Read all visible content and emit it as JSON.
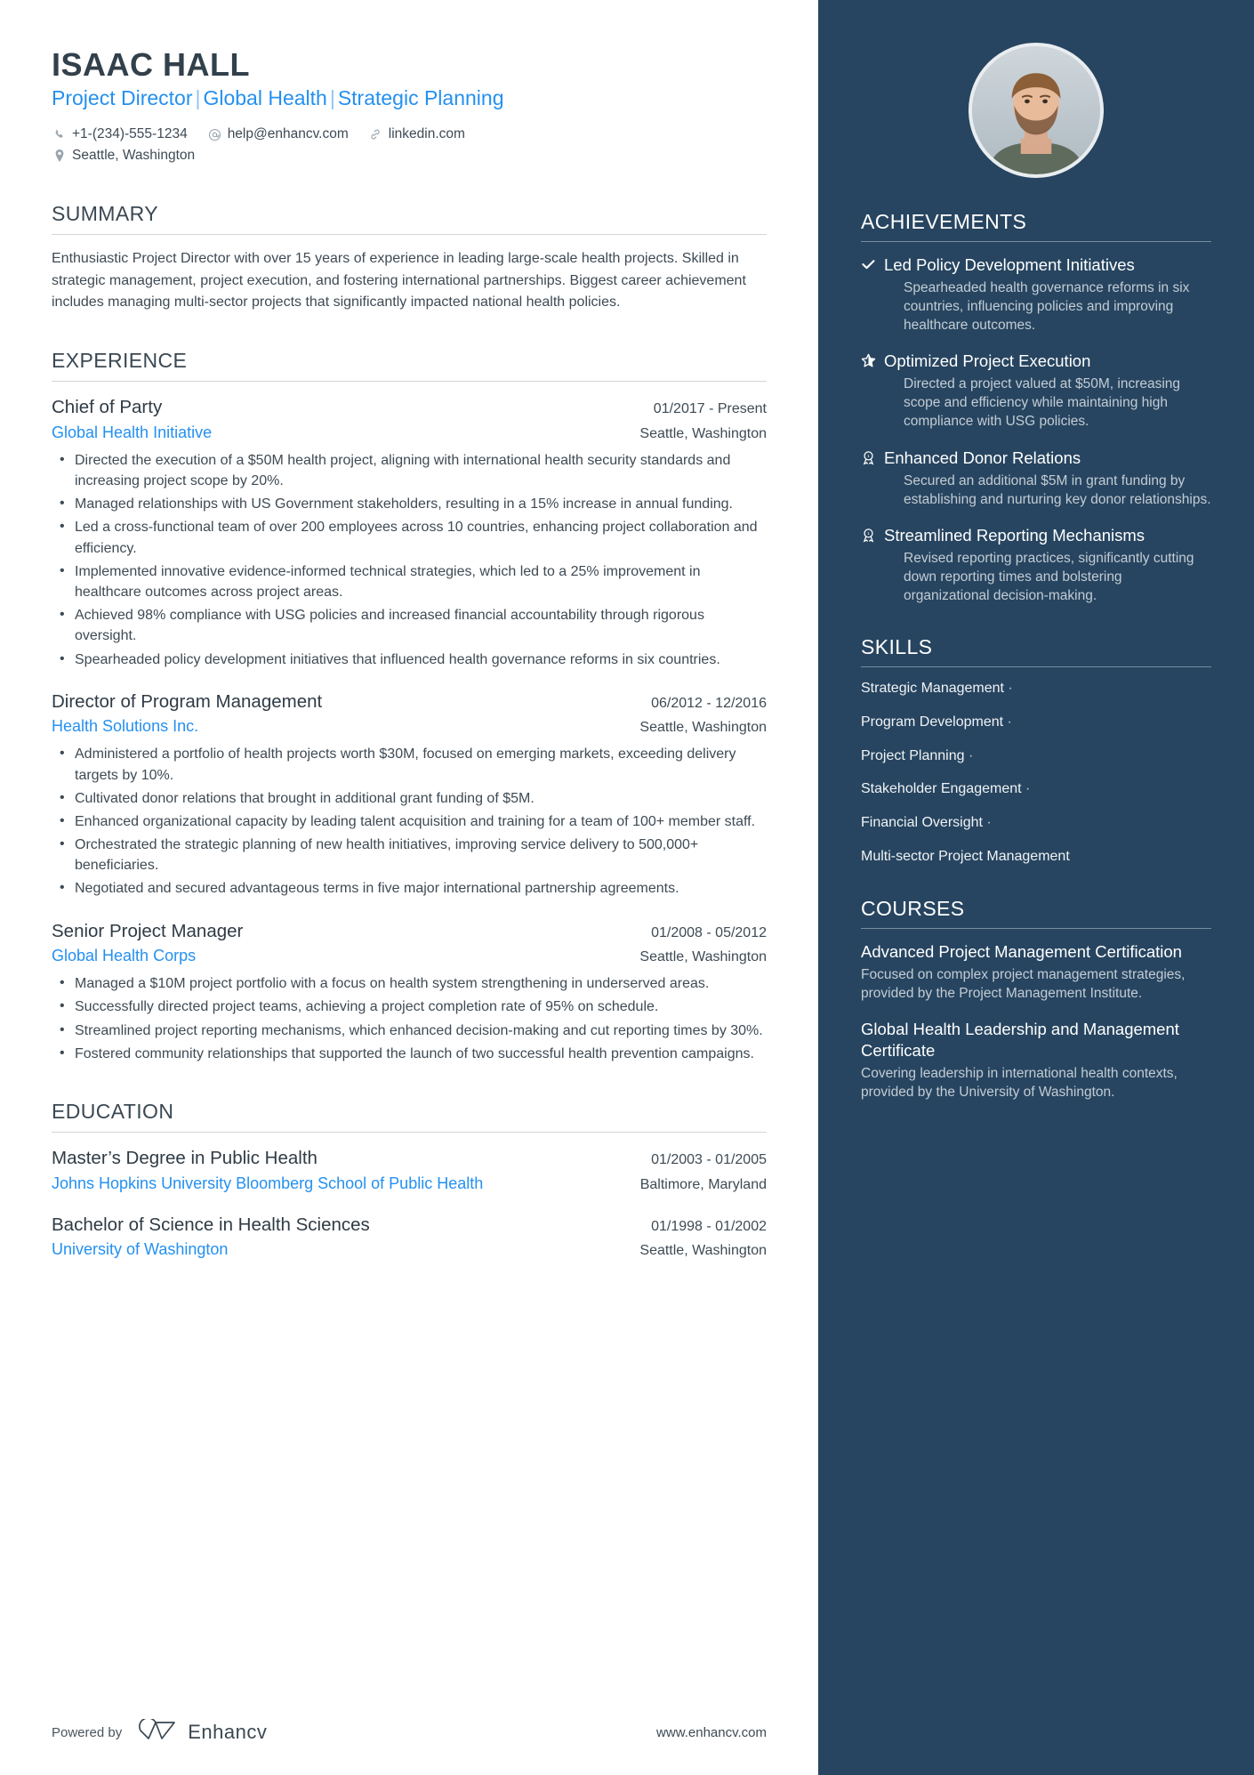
{
  "header": {
    "name": "ISAAC HALL",
    "headline_parts": [
      "Project Director",
      "Global Health",
      "Strategic Planning"
    ],
    "headline": "Project Director | Global Health | Strategic Planning",
    "contacts": [
      {
        "icon": "phone-icon",
        "text": "+1-(234)-555-1234"
      },
      {
        "icon": "email-icon",
        "text": "help@enhancv.com"
      },
      {
        "icon": "link-icon",
        "text": "linkedin.com"
      },
      {
        "icon": "location-icon",
        "text": "Seattle, Washington"
      }
    ]
  },
  "sections": {
    "summary": {
      "title": "SUMMARY",
      "text": "Enthusiastic Project Director with over 15 years of experience in leading large-scale health projects. Skilled in strategic management, project execution, and fostering international partnerships. Biggest career achievement includes managing multi-sector projects that significantly impacted national health policies."
    },
    "experience": {
      "title": "EXPERIENCE",
      "jobs": [
        {
          "title": "Chief of Party",
          "date": "01/2017 - Present",
          "company": "Global Health Initiative",
          "location": "Seattle, Washington",
          "bullets": [
            "Directed the execution of a $50M health project, aligning with international health security standards and increasing project scope by 20%.",
            "Managed relationships with US Government stakeholders, resulting in a 15% increase in annual funding.",
            "Led a cross-functional team of over 200 employees across 10 countries, enhancing project collaboration and efficiency.",
            "Implemented innovative evidence-informed technical strategies, which led to a 25% improvement in healthcare outcomes across project areas.",
            "Achieved 98% compliance with USG policies and increased financial accountability through rigorous oversight.",
            "Spearheaded policy development initiatives that influenced health governance reforms in six countries."
          ]
        },
        {
          "title": "Director of Program Management",
          "date": "06/2012 - 12/2016",
          "company": "Health Solutions Inc.",
          "location": "Seattle, Washington",
          "bullets": [
            "Administered a portfolio of health projects worth $30M, focused on emerging markets, exceeding delivery targets by 10%.",
            "Cultivated donor relations that brought in additional grant funding of $5M.",
            "Enhanced organizational capacity by leading talent acquisition and training for a team of 100+ member staff.",
            "Orchestrated the strategic planning of new health initiatives, improving service delivery to 500,000+ beneficiaries.",
            "Negotiated and secured advantageous terms in five major international partnership agreements."
          ]
        },
        {
          "title": "Senior Project Manager",
          "date": "01/2008 - 05/2012",
          "company": "Global Health Corps",
          "location": "Seattle, Washington",
          "bullets": [
            "Managed a $10M project portfolio with a focus on health system strengthening in underserved areas.",
            "Successfully directed project teams, achieving a project completion rate of 95% on schedule.",
            "Streamlined project reporting mechanisms, which enhanced decision-making and cut reporting times by 30%.",
            "Fostered community relationships that supported the launch of two successful health prevention campaigns."
          ]
        }
      ]
    },
    "education": {
      "title": "EDUCATION",
      "entries": [
        {
          "degree": "Master’s Degree in Public Health",
          "date": "01/2003 - 01/2005",
          "school": "Johns Hopkins University Bloomberg School of Public Health",
          "location": "Baltimore, Maryland"
        },
        {
          "degree": "Bachelor of Science in Health Sciences",
          "date": "01/1998 - 01/2002",
          "school": "University of Washington",
          "location": "Seattle, Washington"
        }
      ]
    },
    "achievements": {
      "title": "ACHIEVEMENTS",
      "items": [
        {
          "icon": "check-icon",
          "title": "Led Policy Development Initiatives",
          "desc": "Spearheaded health governance reforms in six countries, influencing policies and improving healthcare outcomes."
        },
        {
          "icon": "star-half-icon",
          "title": "Optimized Project Execution",
          "desc": "Directed a project valued at $50M, increasing scope and efficiency while maintaining high compliance with USG policies."
        },
        {
          "icon": "award-ribbon-icon",
          "title": "Enhanced Donor Relations",
          "desc": "Secured an additional $5M in grant funding by establishing and nurturing key donor relationships."
        },
        {
          "icon": "award-ribbon-icon",
          "title": "Streamlined Reporting Mechanisms",
          "desc": "Revised reporting practices, significantly cutting down reporting times and bolstering organizational decision-making."
        }
      ]
    },
    "skills": {
      "title": "SKILLS",
      "items": [
        "Strategic Management",
        "Program Development",
        "Project Planning",
        "Stakeholder Engagement",
        "Financial Oversight",
        "Multi-sector Project Management"
      ],
      "separator": "·"
    },
    "courses": {
      "title": "COURSES",
      "items": [
        {
          "title": "Advanced Project Management Certification",
          "desc": "Focused on complex project management strategies, provided by the Project Management Institute."
        },
        {
          "title": "Global Health Leadership and Management Certificate",
          "desc": "Covering leadership in international health contexts, provided by the University of Washington."
        }
      ]
    }
  },
  "footer": {
    "powered_by": "Powered by",
    "brand": "Enhancv",
    "website": "www.enhancv.com"
  },
  "colors": {
    "accent_blue": "#2490f0",
    "sidebar_bg": "#274560",
    "heading": "#3b4852",
    "body_text": "#3e4a54"
  }
}
